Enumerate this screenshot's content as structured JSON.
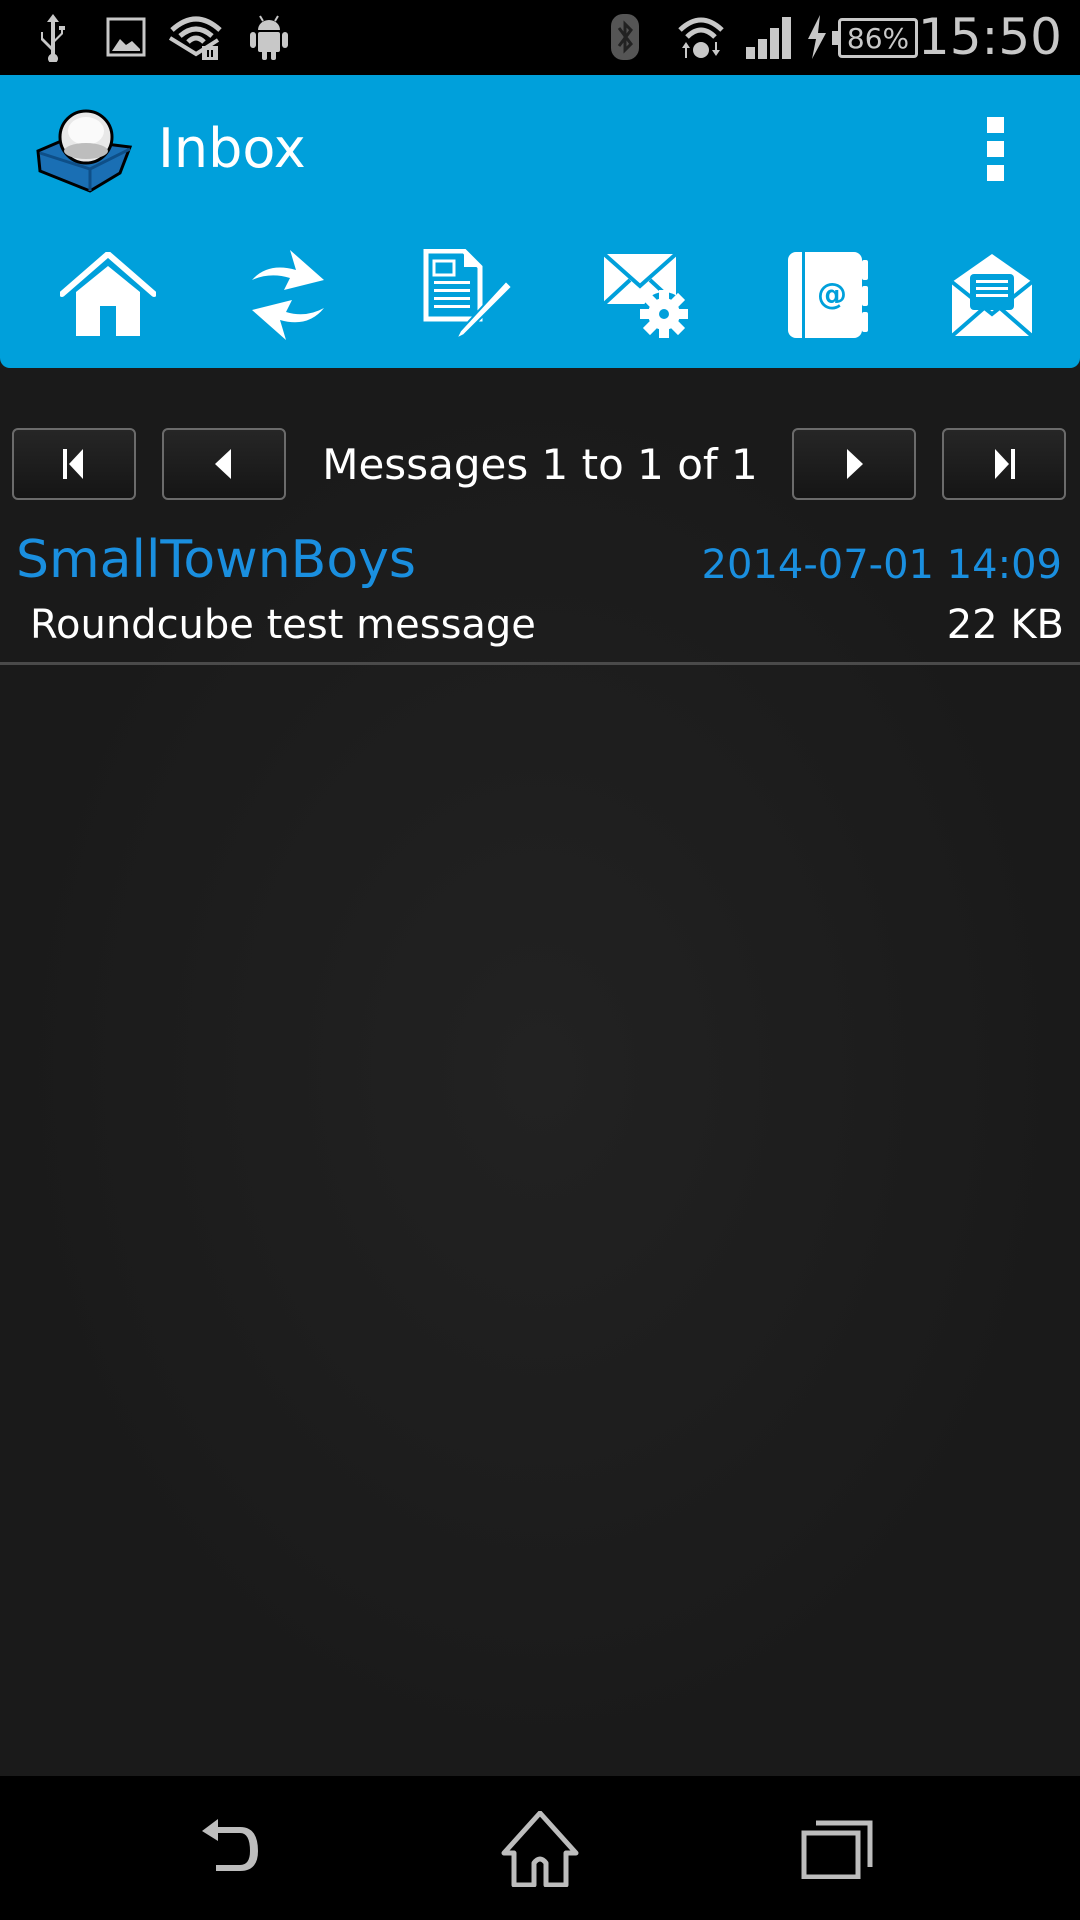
{
  "status_bar": {
    "left_icons": [
      "usb-icon",
      "image-icon",
      "wifi-hotspot-icon",
      "android-icon"
    ],
    "right_icons": [
      "bluetooth-icon",
      "wifi-icon",
      "signal-icon",
      "charging-icon"
    ],
    "battery": "86%",
    "time": "15:50"
  },
  "header": {
    "title": "Inbox",
    "logo": "roundcube-logo",
    "menu_icon": "overflow-menu-icon"
  },
  "toolbar": {
    "buttons": [
      {
        "name": "home",
        "icon": "home-icon"
      },
      {
        "name": "refresh",
        "icon": "refresh-icon"
      },
      {
        "name": "compose",
        "icon": "compose-icon"
      },
      {
        "name": "mail-settings",
        "icon": "mail-settings-icon"
      },
      {
        "name": "address-book",
        "icon": "address-book-icon"
      },
      {
        "name": "open-mail",
        "icon": "open-mail-icon"
      }
    ]
  },
  "pager": {
    "label": "Messages 1 to 1 of 1",
    "buttons": [
      "first",
      "previous",
      "next",
      "last"
    ]
  },
  "messages": [
    {
      "from": "SmallTownBoys",
      "date": "2014-07-01 14:09",
      "subject": "Roundcube test message",
      "size": "22 KB"
    }
  ],
  "colors": {
    "accent": "#00a0db",
    "link": "#1a8fdf",
    "background": "#1b1b1b"
  },
  "nav_bar": {
    "buttons": [
      "back",
      "home",
      "recents"
    ]
  }
}
